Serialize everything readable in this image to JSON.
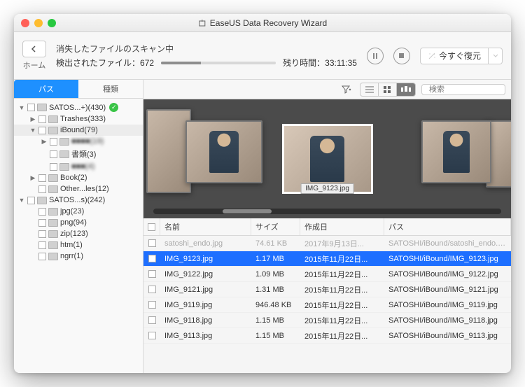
{
  "window": {
    "title": "EaseUS Data Recovery Wizard"
  },
  "toolbar": {
    "home": "ホーム",
    "scan_status": "消失したファイルのスキャン中",
    "files_label": "検出されたファイル：",
    "files_count": "672",
    "remain_label": "残り時間：",
    "remain_time": "33:11:35",
    "recover": "今すぐ復元",
    "search_placeholder": "検索"
  },
  "tabs": {
    "path": "パス",
    "kind": "種類"
  },
  "tree": [
    {
      "indent": 0,
      "disc": "▼",
      "label": "SATOS...+)(430)",
      "check": true
    },
    {
      "indent": 1,
      "disc": "▶",
      "label": "Trashes(333)"
    },
    {
      "indent": 1,
      "disc": "▼",
      "label": "iBound(79)",
      "sel": true
    },
    {
      "indent": 2,
      "disc": "▶",
      "label": "■■■■(19)",
      "blur": true
    },
    {
      "indent": 2,
      "disc": "",
      "label": "書類(3)"
    },
    {
      "indent": 2,
      "disc": "",
      "label": "■■■(4)",
      "blur": true
    },
    {
      "indent": 1,
      "disc": "▶",
      "label": "Book(2)"
    },
    {
      "indent": 1,
      "disc": "",
      "label": "Other...les(12)"
    },
    {
      "indent": 0,
      "disc": "▼",
      "label": "SATOS...s)(242)"
    },
    {
      "indent": 1,
      "disc": "",
      "label": "jpg(23)"
    },
    {
      "indent": 1,
      "disc": "",
      "label": "png(94)"
    },
    {
      "indent": 1,
      "disc": "",
      "label": "zip(123)"
    },
    {
      "indent": 1,
      "disc": "",
      "label": "htm(1)"
    },
    {
      "indent": 1,
      "disc": "",
      "label": "ngrr(1)"
    }
  ],
  "cover": {
    "caption": "IMG_9123.jpg"
  },
  "columns": {
    "name": "名前",
    "size": "サイズ",
    "date": "作成日",
    "path": "パス"
  },
  "rows": [
    {
      "name": "satoshi_endo.jpg",
      "size": "74.61 KB",
      "date": "2017年9月13日...",
      "path": "SATOSHI/iBound/satoshi_endo.jpg",
      "dim": true
    },
    {
      "name": "IMG_9123.jpg",
      "size": "1.17 MB",
      "date": "2015年11月22日...",
      "path": "SATOSHI/iBound/IMG_9123.jpg",
      "sel": true
    },
    {
      "name": "IMG_9122.jpg",
      "size": "1.09 MB",
      "date": "2015年11月22日...",
      "path": "SATOSHI/iBound/IMG_9122.jpg"
    },
    {
      "name": "IMG_9121.jpg",
      "size": "1.31 MB",
      "date": "2015年11月22日...",
      "path": "SATOSHI/iBound/IMG_9121.jpg"
    },
    {
      "name": "IMG_9119.jpg",
      "size": "946.48 KB",
      "date": "2015年11月22日...",
      "path": "SATOSHI/iBound/IMG_9119.jpg"
    },
    {
      "name": "IMG_9118.jpg",
      "size": "1.15 MB",
      "date": "2015年11月22日...",
      "path": "SATOSHI/iBound/IMG_9118.jpg"
    },
    {
      "name": "IMG_9113.jpg",
      "size": "1.15 MB",
      "date": "2015年11月22日...",
      "path": "SATOSHI/iBound/IMG_9113.jpg"
    }
  ]
}
